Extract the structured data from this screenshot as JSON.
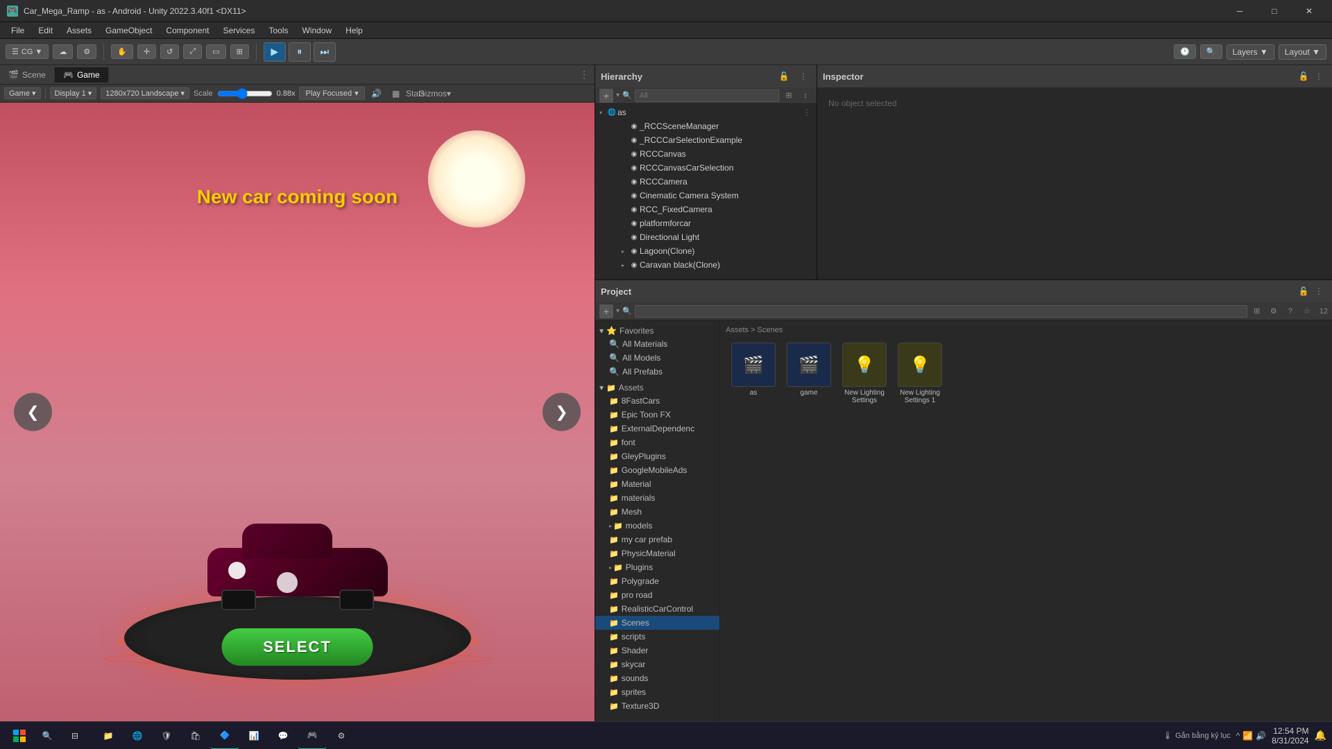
{
  "window": {
    "title": "Car_Mega_Ramp - as - Android - Unity 2022.3.40f1 <DX11>",
    "icon": "🎮"
  },
  "menu": {
    "items": [
      "File",
      "Edit",
      "Assets",
      "GameObject",
      "Component",
      "Services",
      "Tools",
      "Window",
      "Help"
    ]
  },
  "toolbar": {
    "cg_label": "CG ▼",
    "layers_label": "Layers ▼",
    "layout_label": "Layout ▼"
  },
  "tabs": {
    "scene": "Scene",
    "game": "Game"
  },
  "game_toolbar": {
    "display": "Display 1",
    "resolution": "1280x720 Landscape",
    "scale_label": "Scale",
    "scale_value": "0.88x",
    "play_focused": "Play Focused",
    "stats": "Stats",
    "gizmos": "Gizmos"
  },
  "game_view": {
    "text": "New car coming soon",
    "select_btn": "SELECT",
    "nav_left": "❮",
    "nav_right": "❯"
  },
  "hierarchy": {
    "title": "Hierarchy",
    "search_placeholder": "All",
    "items": [
      {
        "label": "as",
        "indent": 0,
        "toggle": "▾",
        "type": "root",
        "selected": false
      },
      {
        "label": "_RCCSceneManager",
        "indent": 2,
        "toggle": "",
        "type": "obj"
      },
      {
        "label": "_RCCCarSelectionExample",
        "indent": 2,
        "toggle": "",
        "type": "obj"
      },
      {
        "label": "RCCCanvas",
        "indent": 2,
        "toggle": "",
        "type": "obj"
      },
      {
        "label": "RCCCanvasCarSelection",
        "indent": 2,
        "toggle": "",
        "type": "obj"
      },
      {
        "label": "RCCCamera",
        "indent": 2,
        "toggle": "",
        "type": "obj"
      },
      {
        "label": "Cinematic Camera System",
        "indent": 2,
        "toggle": "",
        "type": "obj"
      },
      {
        "label": "RCC_FixedCamera",
        "indent": 2,
        "toggle": "",
        "type": "obj"
      },
      {
        "label": "platformforcar",
        "indent": 2,
        "toggle": "",
        "type": "obj"
      },
      {
        "label": "Directional Light",
        "indent": 2,
        "toggle": "",
        "type": "obj"
      },
      {
        "label": "Lagoon(Clone)",
        "indent": 2,
        "toggle": "▸",
        "type": "obj"
      },
      {
        "label": "Caravan black(Clone)",
        "indent": 2,
        "toggle": "▸",
        "type": "obj"
      }
    ]
  },
  "inspector": {
    "title": "Inspector"
  },
  "project": {
    "title": "Project",
    "search_placeholder": "",
    "asset_count": "12",
    "breadcrumb": "Assets > Scenes",
    "favorites": {
      "title": "Favorites",
      "items": [
        "All Materials",
        "All Models",
        "All Prefabs"
      ]
    },
    "assets": {
      "title": "Assets",
      "items": [
        {
          "label": "8FastCars",
          "type": "folder"
        },
        {
          "label": "Epic Toon FX",
          "type": "folder"
        },
        {
          "label": "ExternalDependenc",
          "type": "folder"
        },
        {
          "label": "font",
          "type": "folder"
        },
        {
          "label": "GleyPlugins",
          "type": "folder"
        },
        {
          "label": "GoogleMobileAds",
          "type": "folder"
        },
        {
          "label": "Material",
          "type": "folder"
        },
        {
          "label": "materials",
          "type": "folder"
        },
        {
          "label": "Mesh",
          "type": "folder"
        },
        {
          "label": "models",
          "type": "folder",
          "has_children": true
        },
        {
          "label": "my car prefab",
          "type": "folder"
        },
        {
          "label": "PhysicMaterial",
          "type": "folder"
        },
        {
          "label": "Plugins",
          "type": "folder",
          "has_children": true
        },
        {
          "label": "Polygrade",
          "type": "folder"
        },
        {
          "label": "pro road",
          "type": "folder"
        },
        {
          "label": "RealisticCarControl",
          "type": "folder"
        },
        {
          "label": "Scenes",
          "type": "folder",
          "selected": true
        },
        {
          "label": "scripts",
          "type": "folder"
        },
        {
          "label": "Shader",
          "type": "folder"
        },
        {
          "label": "skycar",
          "type": "folder"
        },
        {
          "label": "sounds",
          "type": "folder"
        },
        {
          "label": "sprites",
          "type": "folder"
        },
        {
          "label": "Texture3D",
          "type": "folder"
        }
      ]
    },
    "scenes": {
      "items": [
        {
          "label": "as",
          "type": "scene"
        },
        {
          "label": "game",
          "type": "scene"
        },
        {
          "label": "New Lighting Settings",
          "type": "light"
        },
        {
          "label": "New Lighting Settings 1",
          "type": "light"
        }
      ]
    }
  },
  "taskbar": {
    "time": "12:54 PM",
    "date": "8/31/2024",
    "system_text": "Gắn bằng kỷ lục"
  }
}
